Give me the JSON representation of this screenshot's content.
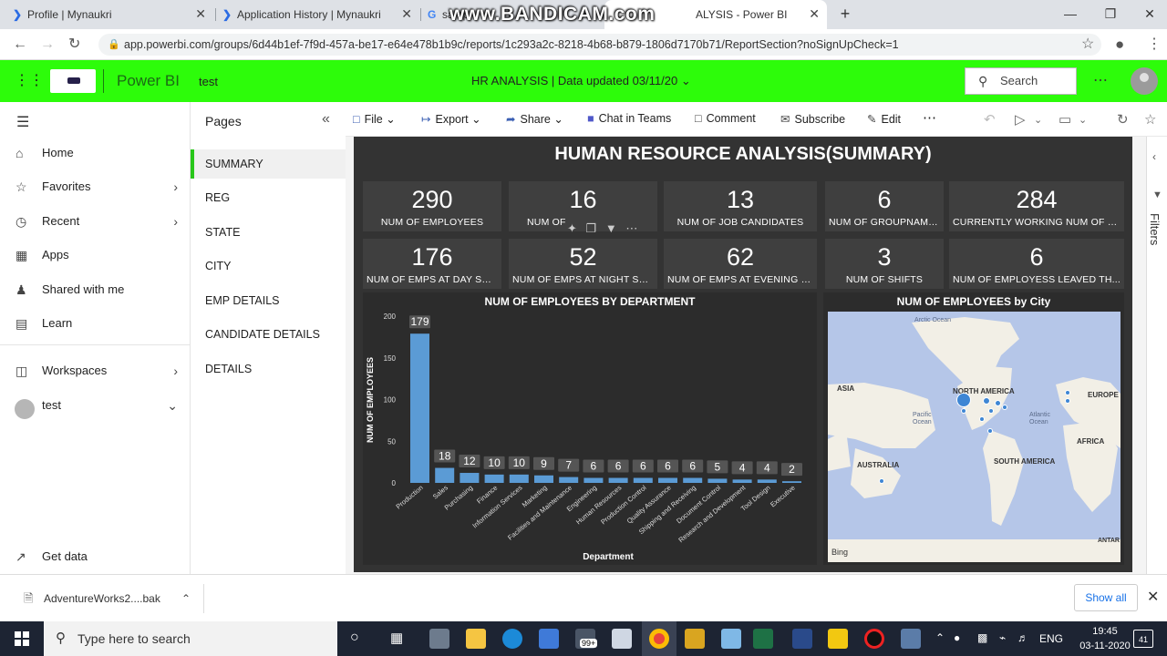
{
  "browser": {
    "tabs": [
      {
        "title": "Profile | Mynaukri",
        "icon": "mynaukri-icon"
      },
      {
        "title": "Application History | Mynaukri",
        "icon": "mynaukri-icon"
      },
      {
        "title": "samp",
        "icon": "google-icon"
      },
      {
        "title": "ALYSIS - Power BI",
        "icon": "powerbi-icon"
      }
    ],
    "watermark": "www.BANDICAM.com",
    "url": "app.powerbi.com/groups/6d44b1ef-7f9d-457a-be17-e64e478b1b9c/reports/1c293a2c-8218-4b68-b879-1806d7170b71/ReportSection?noSignUpCheck=1"
  },
  "header": {
    "app_name": "Power BI",
    "workspace": "test",
    "report_info": "HR ANALYSIS  |  Data updated 03/11/20",
    "search_label": "Search",
    "accent": "#2DFC0A"
  },
  "leftnav": {
    "items": [
      {
        "label": "Home",
        "icon": "home-icon"
      },
      {
        "label": "Favorites",
        "icon": "star-icon"
      },
      {
        "label": "Recent",
        "icon": "clock-icon"
      },
      {
        "label": "Apps",
        "icon": "apps-icon"
      },
      {
        "label": "Shared with me",
        "icon": "shared-icon"
      },
      {
        "label": "Learn",
        "icon": "book-icon"
      },
      {
        "label": "Workspaces",
        "icon": "workspaces-icon"
      },
      {
        "label": "test",
        "icon": "workspace-avatar"
      }
    ],
    "get_data": "Get data"
  },
  "pages": {
    "title": "Pages",
    "items": [
      "SUMMARY",
      "REG",
      "STATE",
      "CITY",
      "EMP DETAILS",
      "CANDIDATE DETAILS",
      "DETAILS"
    ],
    "selected": "SUMMARY"
  },
  "toolbar": {
    "file": "File",
    "export": "Export",
    "share": "Share",
    "teams": "Chat in Teams",
    "comment": "Comment",
    "subscribe": "Subscribe",
    "edit": "Edit"
  },
  "report": {
    "title": "HUMAN RESOURCE ANALYSIS(SUMMARY)",
    "cards": [
      {
        "value": "290",
        "label": "NUM OF EMPLOYEES"
      },
      {
        "value": "16",
        "label": "NUM OF"
      },
      {
        "value": "13",
        "label": "NUM OF JOB CANDIDATES"
      },
      {
        "value": "6",
        "label": "NUM OF GROUPNAMES"
      },
      {
        "value": "284",
        "label": "CURRENTLY WORKING NUM OF E..."
      },
      {
        "value": "176",
        "label": "NUM OF EMPS AT DAY SHI..."
      },
      {
        "value": "52",
        "label": "NUM OF EMPS AT NIGHT SH..."
      },
      {
        "value": "62",
        "label": "NUM OF EMPS AT EVENING S..."
      },
      {
        "value": "3",
        "label": "NUM OF SHIFTS"
      },
      {
        "value": "6",
        "label": "NUM OF EMPLOYESS LEAVED TH..."
      }
    ],
    "map_title": "NUM OF EMPLOYEES by City",
    "map_labels": [
      "Arctic Ocean",
      "ASIA",
      "NORTH AMERICA",
      "EUROPE",
      "Pacific Ocean",
      "Atlantic Ocean",
      "AFRICA",
      "AUSTRALIA",
      "SOUTH AMERICA",
      "ANTAR"
    ],
    "map_attrib": "Bing",
    "filters_label": "Filters"
  },
  "chart_data": {
    "type": "bar",
    "title": "NUM OF EMPLOYEES BY DEPARTMENT",
    "xlabel": "Department",
    "ylabel": "NUM OF EMPLOYEES",
    "ylim": [
      0,
      200
    ],
    "yticks": [
      0,
      50,
      100,
      150,
      200
    ],
    "categories": [
      "Production",
      "Sales",
      "Purchasing",
      "Finance",
      "Information Services",
      "Marketing",
      "Facilities and Maintenance",
      "Engineering",
      "Human Resources",
      "Production Control",
      "Quality Assurance",
      "Shipping and Receiving",
      "Document Control",
      "Research and Development",
      "Tool Design",
      "Executive"
    ],
    "values": [
      179,
      18,
      12,
      10,
      10,
      9,
      7,
      6,
      6,
      6,
      6,
      6,
      5,
      4,
      4,
      2
    ],
    "bar_color": "#5B9BD5"
  },
  "downloads": {
    "file": "AdventureWorks2....bak",
    "show_all": "Show all"
  },
  "taskbar": {
    "search_placeholder": "Type here to search",
    "badge": "99+",
    "lang": "ENG",
    "time": "19:45",
    "date": "03-11-2020",
    "notif": "41"
  }
}
